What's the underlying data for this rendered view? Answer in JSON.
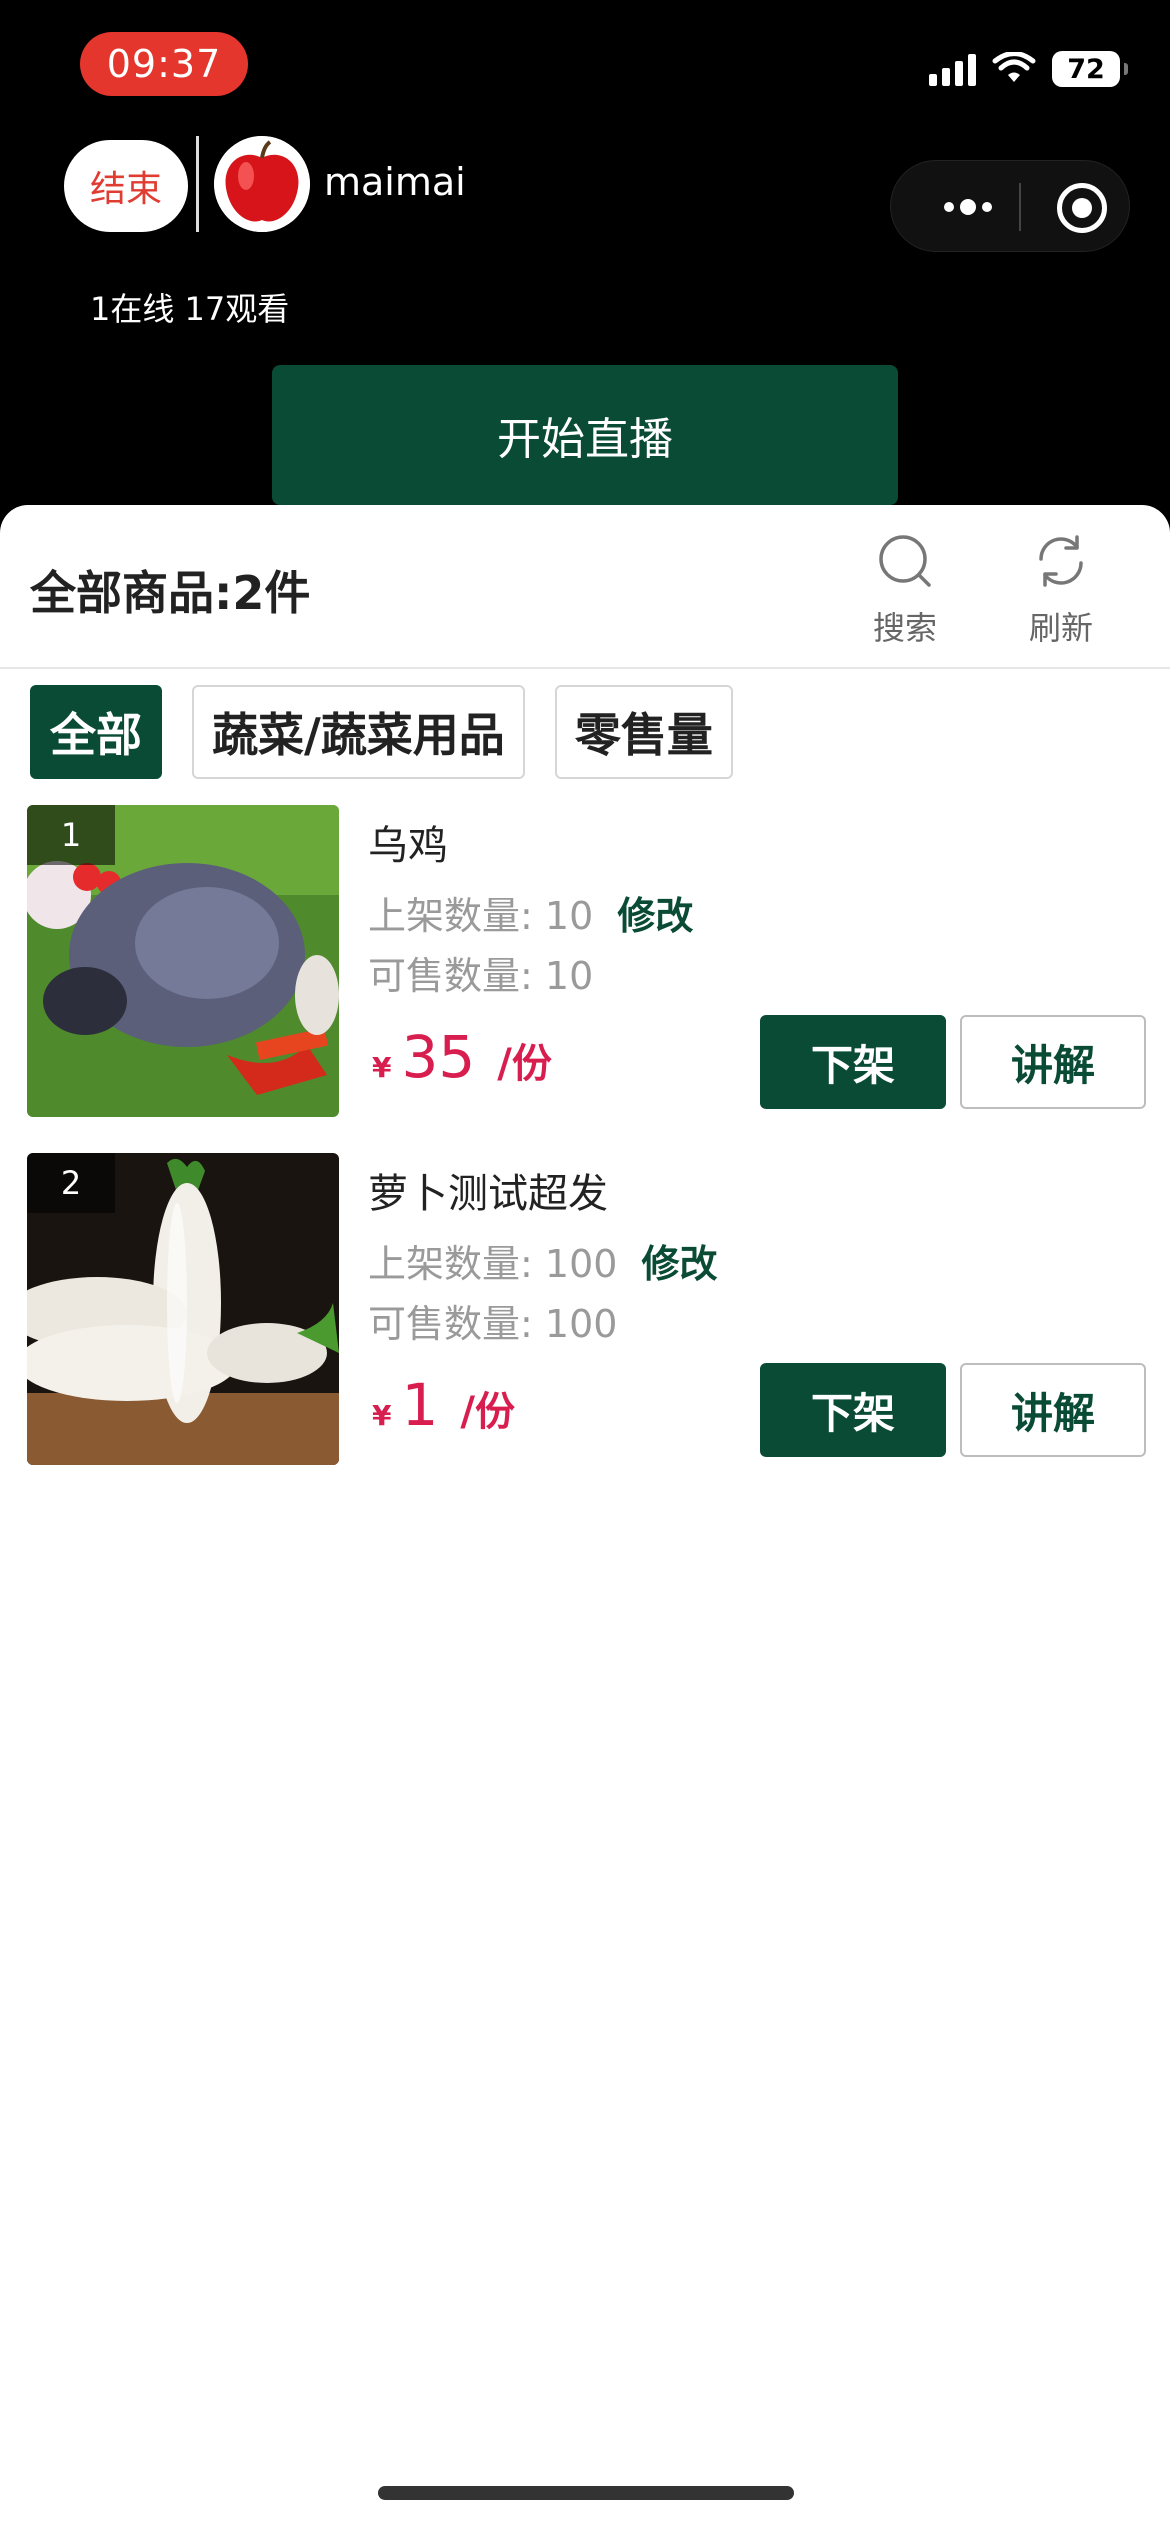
{
  "status_bar": {
    "time": "09:37",
    "battery": "72"
  },
  "header": {
    "end_label": "结束",
    "username": "maimai",
    "viewers": "1在线 17观看",
    "start_live_label": "开始直播"
  },
  "panel": {
    "title": "全部商品:2件",
    "search_label": "搜索",
    "refresh_label": "刷新",
    "tabs": [
      {
        "label": "全部",
        "active": true
      },
      {
        "label": "蔬菜/蔬菜用品",
        "active": false
      },
      {
        "label": "零售量",
        "active": false
      }
    ]
  },
  "products": [
    {
      "index": "1",
      "name": "乌鸡",
      "listed_label": "上架数量:",
      "listed_qty": "10",
      "edit_label": "修改",
      "available_label": "可售数量:",
      "available_qty": "10",
      "currency": "¥",
      "price": "35",
      "unit": "/份",
      "down_label": "下架",
      "explain_label": "讲解"
    },
    {
      "index": "2",
      "name": "萝卜测试超发",
      "listed_label": "上架数量:",
      "listed_qty": "100",
      "edit_label": "修改",
      "available_label": "可售数量:",
      "available_qty": "100",
      "currency": "¥",
      "price": "1",
      "unit": "/份",
      "down_label": "下架",
      "explain_label": "讲解"
    }
  ],
  "colors": {
    "primary_green": "#0a4b35",
    "price_red": "#d81e4f",
    "end_red": "#e03c31"
  }
}
